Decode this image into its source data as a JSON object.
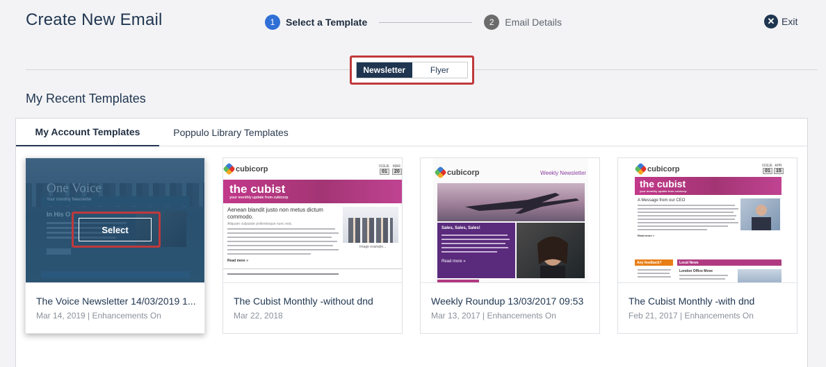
{
  "header": {
    "title": "Create New Email",
    "steps": [
      {
        "number": "1",
        "label": "Select a Template",
        "state": "active"
      },
      {
        "number": "2",
        "label": "Email Details",
        "state": "inactive"
      }
    ],
    "exit_label": "Exit"
  },
  "toggle": {
    "options": [
      "Newsletter",
      "Flyer"
    ],
    "selected": "Newsletter"
  },
  "section_title": "My Recent Templates",
  "tabs": [
    "My Account Templates",
    "Poppulo Library Templates"
  ],
  "active_tab": "My Account Templates",
  "cards": [
    {
      "title": "The Voice Newsletter 14/03/2019 1...",
      "meta": "Mar 14, 2019 | Enhancements On",
      "thumb": "one-voice",
      "select_label": "Select"
    },
    {
      "title": "The Cubist Monthly -without dnd",
      "meta": "Mar 22, 2018",
      "thumb": "cubist-without-dnd"
    },
    {
      "title": "Weekly Roundup 13/03/2017 09:53",
      "meta": "Mar 13, 2017 | Enhancements On",
      "thumb": "weekly-newsletter"
    },
    {
      "title": "The Cubist Monthly -with dnd",
      "meta": "Feb 21, 2017 | Enhancements On",
      "thumb": "cubist-with-dnd"
    }
  ],
  "thumbnails": {
    "one_voice": {
      "heading": "One Voice",
      "subheading": "Your monthly Newsletter",
      "story_title": "In His O"
    },
    "cubist_a": {
      "brand": "cubicorp",
      "banner_title": "the cubist",
      "banner_sub": "your monthly update from cubicorp",
      "issue_label": "ISSUE",
      "issue_value": "01",
      "month_label": "MAR",
      "month_value": "20",
      "headline": "Aenean blandit justo non metus dictum commodo.",
      "byline": "Aliquam vulputate pellentesque nunc erat.",
      "read_more": "Read more »",
      "caption": "Image example..."
    },
    "weekly": {
      "brand": "cubicorp",
      "label": "Weekly Newsletter",
      "promo_title": "Sales, Sales, Sales!",
      "read_more": "Read more »"
    },
    "cubist_b": {
      "brand": "cubicorp",
      "banner_title": "the cubist",
      "banner_sub": "your monthly update from cubicorp",
      "issue_label": "ISSUE",
      "issue_value": "01",
      "month_label": "APR",
      "month_value": "15",
      "headline": "A Message from our CEO",
      "read_more": "Read more »",
      "box1_title": "Any feedback?",
      "box2_title": "Local News",
      "box2_headline": "London Office Move"
    }
  },
  "colors": {
    "navy": "#1f3550",
    "step_active": "#2f6fd6",
    "highlight_red": "#c0393b",
    "cubist_magenta": "#b03a80",
    "weekly_purple": "#5a2a7c"
  }
}
